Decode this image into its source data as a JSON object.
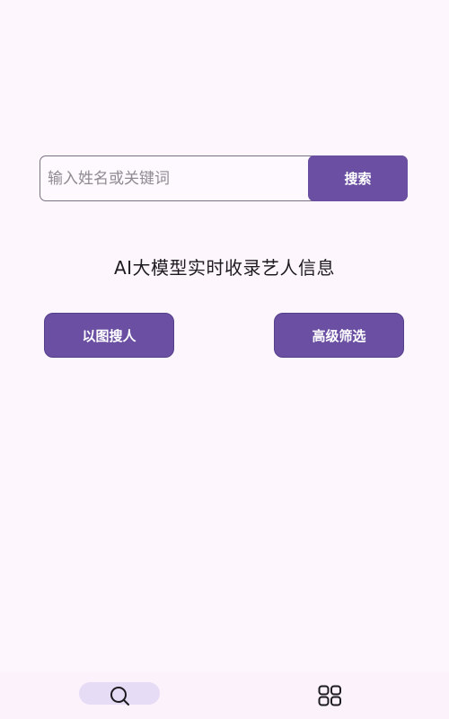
{
  "search": {
    "placeholder": "输入姓名或关键词",
    "value": "",
    "button_label": "搜索"
  },
  "tagline": "AI大模型实时收录艺人信息",
  "actions": {
    "image_search_label": "以图搜人",
    "advanced_filter_label": "高级筛选"
  },
  "bottom_nav": {
    "items": [
      {
        "icon": "search-icon",
        "active": true
      },
      {
        "icon": "grid-icon",
        "active": false
      }
    ]
  },
  "colors": {
    "background": "#fdf7fd",
    "primary": "#6a4fa3",
    "active_pill": "#e7dcf6",
    "text": "#1d1b20"
  }
}
